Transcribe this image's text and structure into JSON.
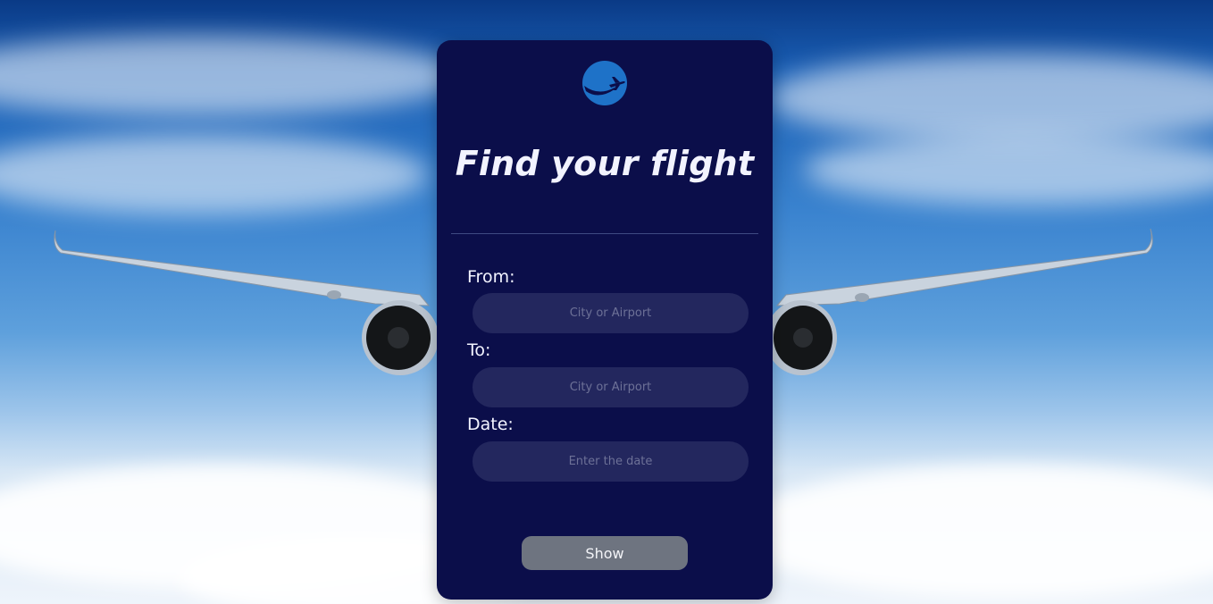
{
  "app": {
    "logo_icon": "plane-globe-icon",
    "title": "Find your flight"
  },
  "form": {
    "from": {
      "label": "From:",
      "placeholder": "City or Airport",
      "value": ""
    },
    "to": {
      "label": "To:",
      "placeholder": "City or Airport",
      "value": ""
    },
    "date": {
      "label": "Date:",
      "placeholder": "Enter the date",
      "value": ""
    },
    "submit_label": "Show"
  },
  "colors": {
    "card_bg": "#0b0e4a",
    "field_bg": "#23275e",
    "logo_blue": "#1e72c8",
    "button_bg": "#6e7480",
    "text": "#f2f3ff"
  }
}
